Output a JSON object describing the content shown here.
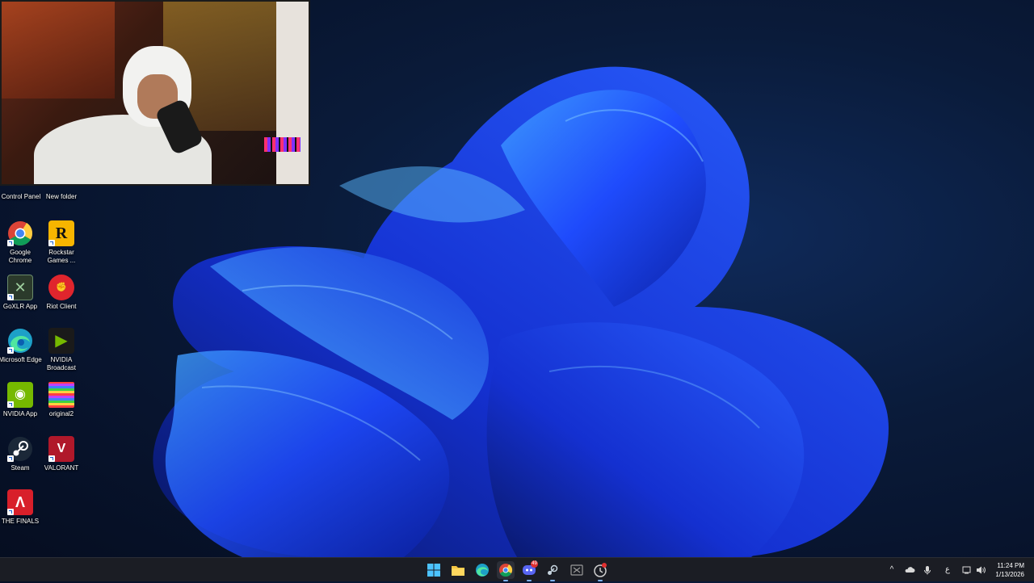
{
  "desktop": {
    "top_labels": [
      "Control Panel",
      "New folder"
    ],
    "icons": [
      {
        "label": "Google Chrome",
        "icon": "chrome-icon",
        "color": "#4285f4"
      },
      {
        "label": "Rockstar Games ...",
        "icon": "rockstar-icon",
        "color": "#f7b500"
      },
      {
        "label": "GoXLR App",
        "icon": "goxlr-icon",
        "color": "#2b3a2b"
      },
      {
        "label": "Riot Client",
        "icon": "riot-icon",
        "color": "#e0252d"
      },
      {
        "label": "Microsoft Edge",
        "icon": "edge-icon",
        "color": "#1da0c8"
      },
      {
        "label": "NVIDIA Broadcast",
        "icon": "nvidia-broadcast-icon",
        "color": "#76b900"
      },
      {
        "label": "NVIDIA App",
        "icon": "nvidia-icon",
        "color": "#76b900"
      },
      {
        "label": "original2",
        "icon": "image-file-icon",
        "color": "#d8b030"
      },
      {
        "label": "Steam",
        "icon": "steam-icon",
        "color": "#1b2838"
      },
      {
        "label": "VALORANT",
        "icon": "valorant-icon",
        "color": "#b0182a"
      },
      {
        "label": "THE FINALS",
        "icon": "the-finals-icon",
        "color": "#d81f2a"
      }
    ]
  },
  "taskbar": {
    "apps": [
      "start-icon",
      "file-explorer-icon",
      "edge-icon",
      "chrome-icon",
      "discord-icon",
      "steam-icon",
      "goxlr-icon",
      "riot-icon"
    ],
    "discord_badge": "49",
    "tray": {
      "chevron": "^",
      "input_indicator": "ع"
    },
    "clock": {
      "time": "11:24 PM",
      "date": "1/13/2026"
    }
  },
  "colors": {
    "accent": "#0078d4",
    "taskbar": "#1b1d24",
    "wallpaper_blue": "#1f4cff"
  }
}
